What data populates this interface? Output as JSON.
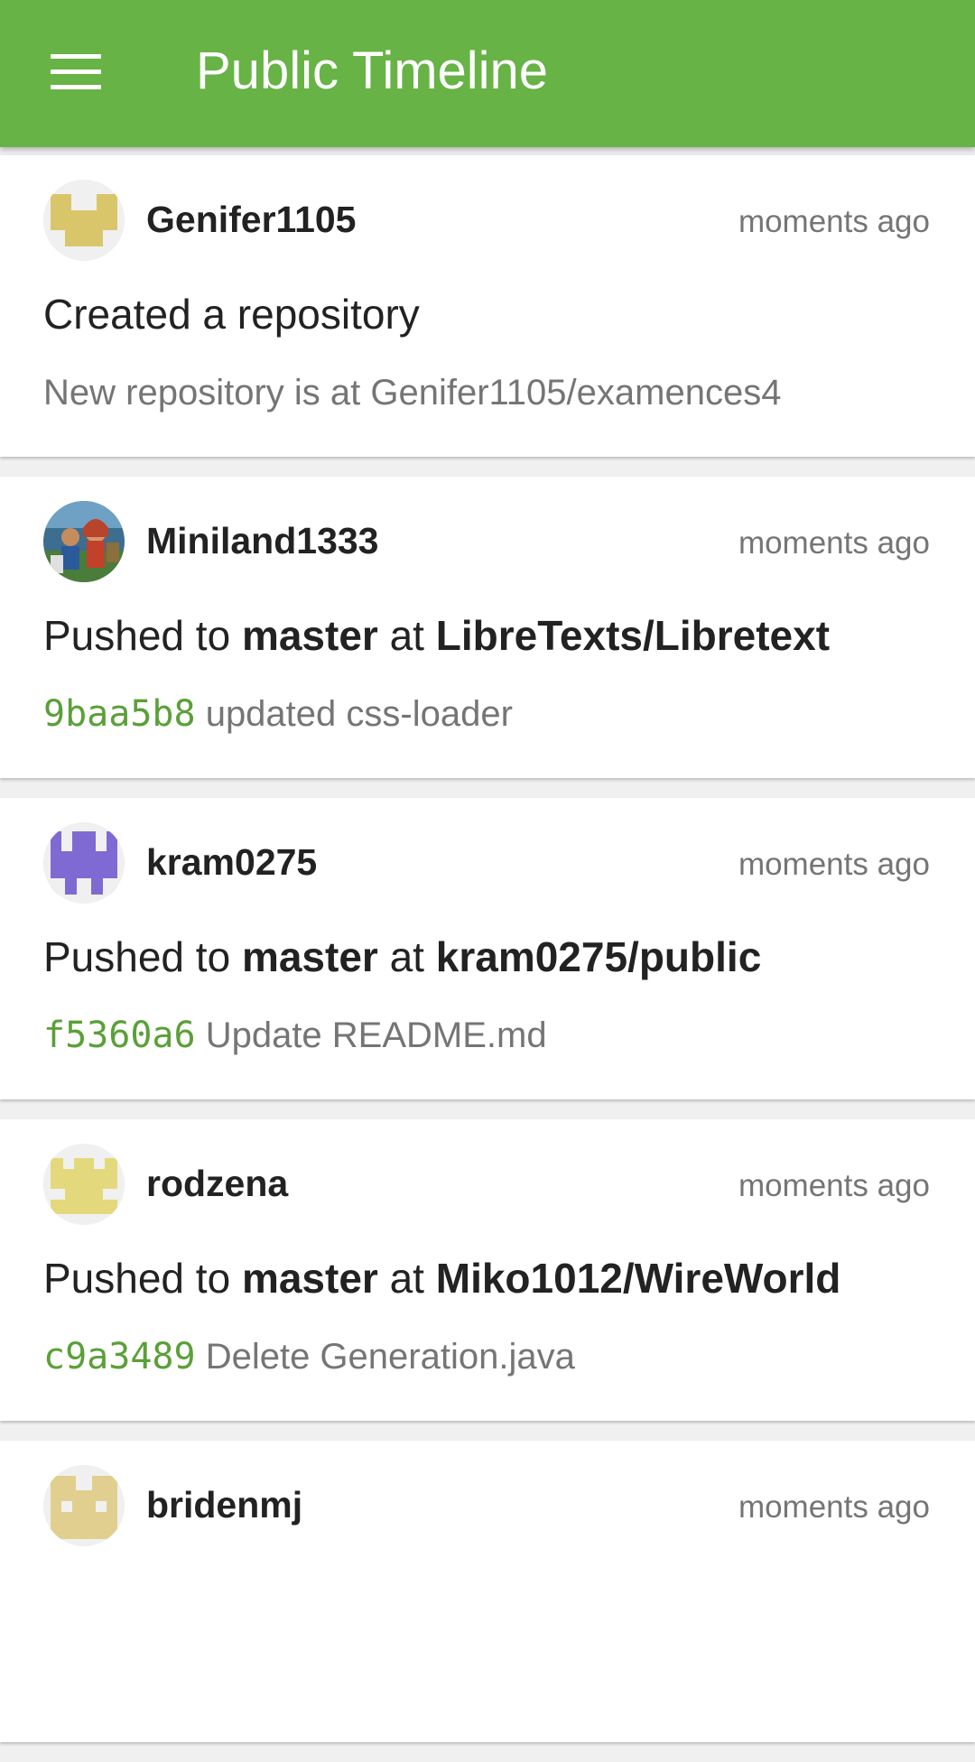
{
  "appbar": {
    "title": "Public Timeline",
    "menu_icon": "hamburger-menu-icon",
    "color": "#67b346"
  },
  "events": [
    {
      "user": "Genifer1105",
      "time": "moments ago",
      "avatar": {
        "kind": "identicon",
        "color": "#d9c66b"
      },
      "action": "Created a repository",
      "detail": "New repository is at Genifer1105/examences4"
    },
    {
      "user": "Miniland1333",
      "time": "moments ago",
      "avatar": {
        "kind": "photo"
      },
      "action_prefix": "Pushed to ",
      "branch": "master",
      "action_mid": " at ",
      "repo": "LibreTexts/Libretext",
      "sha": "9baa5b8",
      "message": " updated css-loader"
    },
    {
      "user": "kram0275",
      "time": "moments ago",
      "avatar": {
        "kind": "identicon",
        "color": "#7f6ad3"
      },
      "action_prefix": "Pushed to ",
      "branch": "master",
      "action_mid": " at ",
      "repo": "kram0275/public",
      "sha": "f5360a6",
      "message": " Update README.md"
    },
    {
      "user": "rodzena",
      "time": "moments ago",
      "avatar": {
        "kind": "identicon",
        "color": "#e3d97c"
      },
      "action_prefix": "Pushed to ",
      "branch": "master",
      "action_mid": " at ",
      "repo": "Miko1012/WireWorld",
      "sha": "c9a3489",
      "message": " Delete Generation.java"
    },
    {
      "user": "bridenmj",
      "time": "moments ago",
      "avatar": {
        "kind": "identicon",
        "color": "#e0cf8e"
      }
    }
  ],
  "colors": {
    "sha": "#5aa038",
    "secondary_text": "#757575"
  }
}
